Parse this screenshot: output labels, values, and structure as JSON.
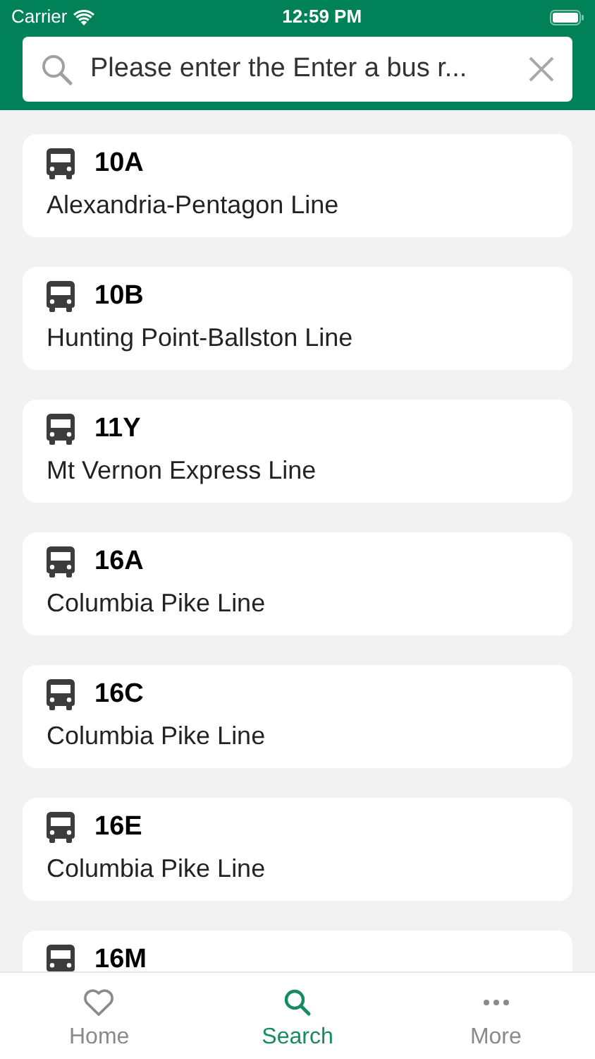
{
  "status_bar": {
    "carrier": "Carrier",
    "time": "12:59 PM"
  },
  "search": {
    "value": "Please enter the Enter a bus r..."
  },
  "routes": [
    {
      "number": "10A",
      "name": "Alexandria-Pentagon Line"
    },
    {
      "number": "10B",
      "name": "Hunting Point-Ballston Line"
    },
    {
      "number": "11Y",
      "name": "Mt Vernon Express Line"
    },
    {
      "number": "16A",
      "name": "Columbia Pike Line"
    },
    {
      "number": "16C",
      "name": "Columbia Pike Line"
    },
    {
      "number": "16E",
      "name": "Columbia Pike Line"
    },
    {
      "number": "16M"
    }
  ],
  "tabs": [
    {
      "kind": "home",
      "label": "Home",
      "selected": false
    },
    {
      "kind": "search",
      "label": "Search",
      "selected": true
    },
    {
      "kind": "more",
      "label": "More",
      "selected": false
    }
  ]
}
